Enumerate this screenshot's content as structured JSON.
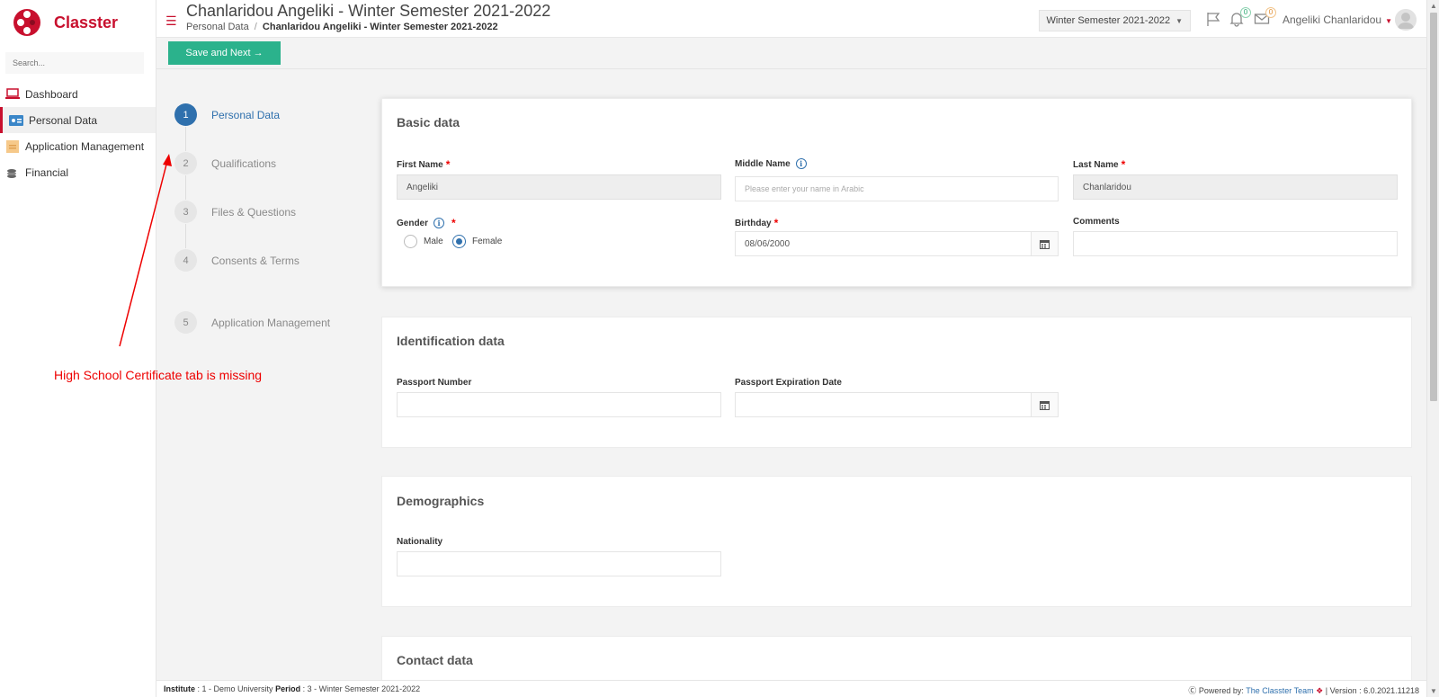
{
  "app": {
    "name": "Classter",
    "brand_color": "#c8102e",
    "accent_color": "#2f70ad",
    "button_color": "#2bb28c"
  },
  "sidebar": {
    "search_placeholder": "Search...",
    "items": [
      {
        "label": "Dashboard",
        "icon": "laptop-icon"
      },
      {
        "label": "Personal Data",
        "icon": "id-card-icon",
        "active": true
      },
      {
        "label": "Application Management",
        "icon": "folder-icon"
      },
      {
        "label": "Financial",
        "icon": "coins-icon"
      }
    ]
  },
  "header": {
    "title": "Chanlaridou Angeliki - Winter Semester 2021-2022",
    "breadcrumb": {
      "root": "Personal Data",
      "separator": "/",
      "current": "Chanlaridou Angeliki - Winter Semester 2021-2022"
    },
    "period_select": "Winter Semester 2021-2022",
    "notifications_count": "0",
    "messages_count": "0",
    "user_name": "Angeliki Chanlaridou"
  },
  "toolbar": {
    "save_label": "Save and Next →"
  },
  "steps": [
    {
      "num": "1",
      "label": "Personal Data",
      "active": true
    },
    {
      "num": "2",
      "label": "Qualifications"
    },
    {
      "num": "3",
      "label": "Files & Questions"
    },
    {
      "num": "4",
      "label": "Consents & Terms"
    },
    {
      "num": "5",
      "label": "Application Management"
    }
  ],
  "annotation": {
    "text": "High School Certificate tab is missing"
  },
  "basic_data": {
    "title": "Basic data",
    "first_name_label": "First Name",
    "first_name_value": "Angeliki",
    "middle_name_label": "Middle Name",
    "middle_name_placeholder": "Please enter your name in Arabic",
    "last_name_label": "Last Name",
    "last_name_value": "Chanlaridou",
    "gender_label": "Gender",
    "gender_options": [
      "Male",
      "Female"
    ],
    "gender_selected": "Female",
    "birthday_label": "Birthday",
    "birthday_value": "08/06/2000",
    "comments_label": "Comments",
    "required_mark": "*"
  },
  "identification_data": {
    "title": "Identification data",
    "passport_number_label": "Passport Number",
    "passport_expiration_label": "Passport Expiration Date"
  },
  "demographics": {
    "title": "Demographics",
    "nationality_label": "Nationality"
  },
  "contact_data": {
    "title": "Contact data"
  },
  "footer": {
    "institute_label": "Institute",
    "institute_value": ": 1 - Demo University",
    "period_label": "Period",
    "period_value": ": 3 - Winter Semester 2021-2022",
    "powered_by": "Powered by:",
    "team_link": "The Classter Team",
    "version": "| Version : 6.0.2021.11218"
  }
}
